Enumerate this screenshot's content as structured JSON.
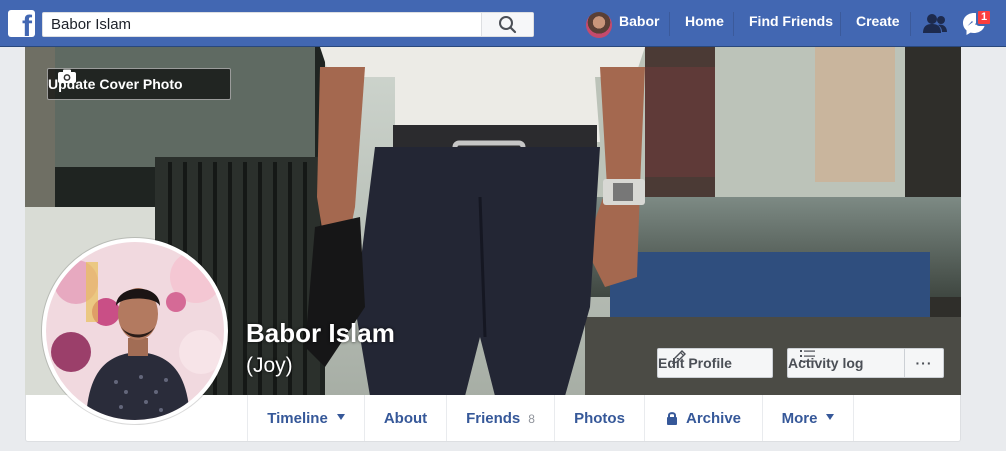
{
  "topbar": {
    "search_value": "Babor Islam",
    "user_name": "Babor",
    "home_label": "Home",
    "find_friends_label": "Find Friends",
    "create_label": "Create",
    "messages_badge": "1",
    "colors": {
      "brand": "#4267b2",
      "badge": "#fa3e3e"
    }
  },
  "cover": {
    "update_cover_label": "Update Cover Photo"
  },
  "profile": {
    "name": "Babor Islam",
    "alternate_name": "(Joy)",
    "edit_profile_label": "Edit Profile",
    "activity_log_label": "Activity log",
    "more_options_label": "···"
  },
  "tabs": [
    {
      "label": "Timeline",
      "icon": "caret-down-icon"
    },
    {
      "label": "About"
    },
    {
      "label": "Friends",
      "count": "8"
    },
    {
      "label": "Photos"
    },
    {
      "label": "Archive",
      "icon": "lock-icon"
    },
    {
      "label": "More",
      "icon": "caret-down-icon"
    }
  ]
}
